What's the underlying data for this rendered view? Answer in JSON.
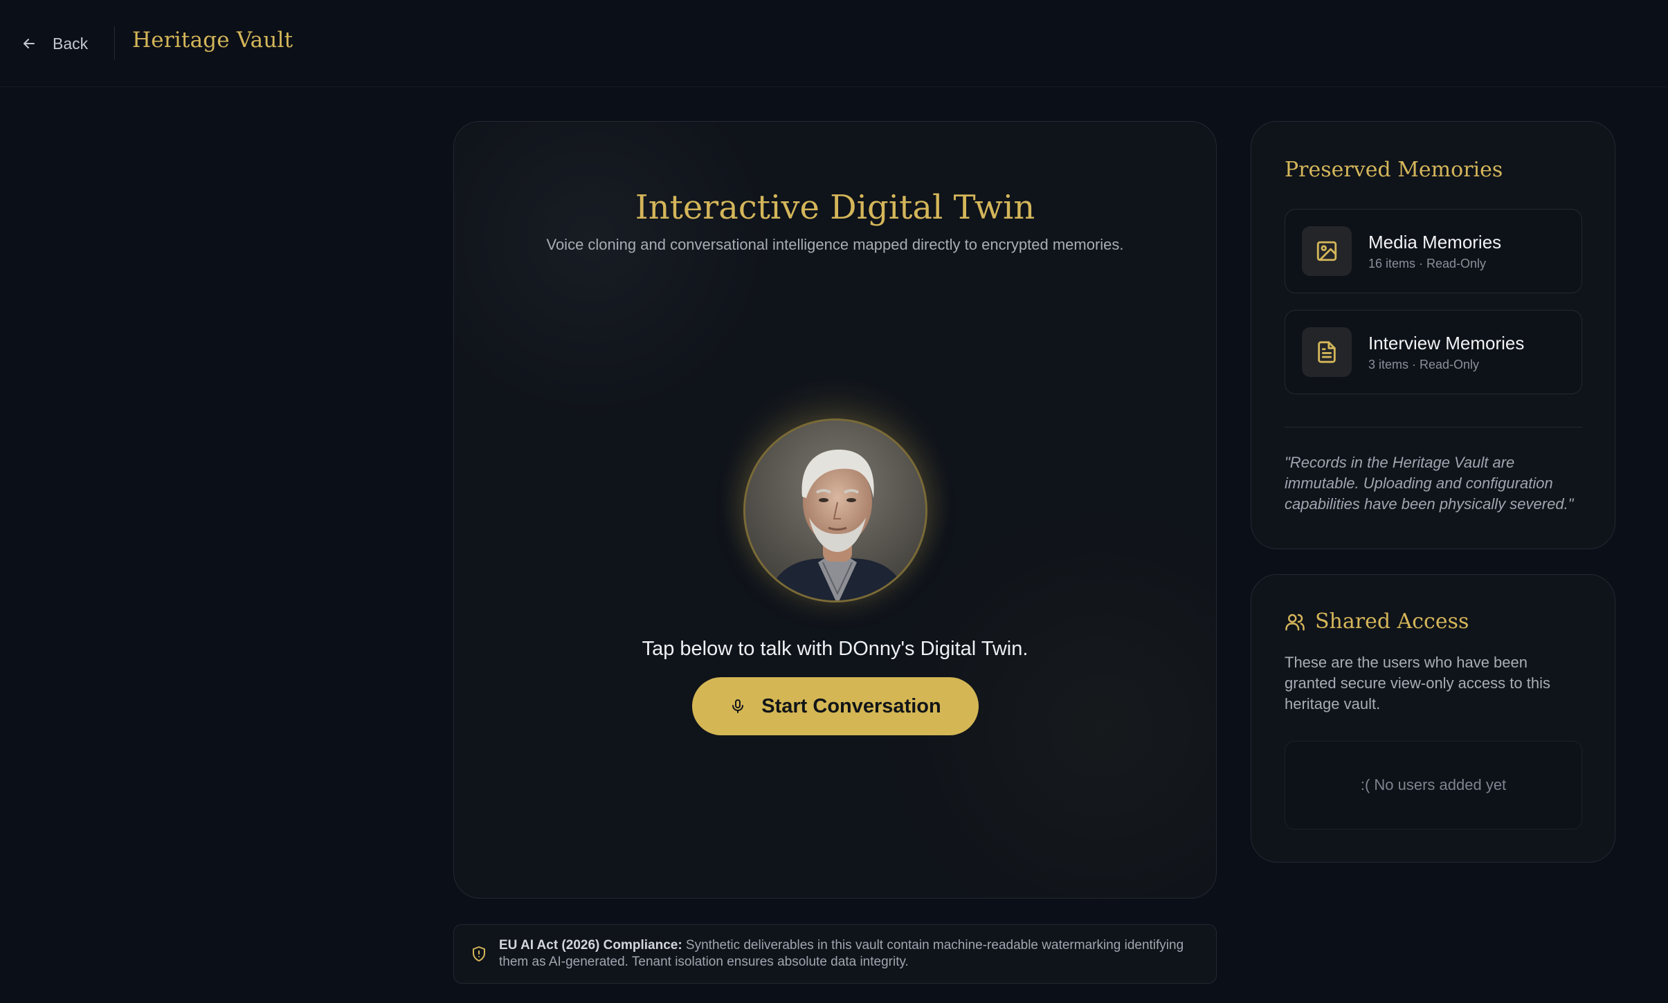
{
  "header": {
    "back_label": "Back",
    "brand": "Heritage Vault"
  },
  "main": {
    "title": "Interactive Digital Twin",
    "subtitle": "Voice cloning and conversational intelligence mapped directly to encrypted memories.",
    "prompt": "Tap below to talk with DOnny's Digital Twin.",
    "start_button": "Start Conversation"
  },
  "compliance": {
    "label": "EU AI Act (2026) Compliance:",
    "text": " Synthetic deliverables in this vault contain machine-readable watermarking identifying them as AI-generated. Tenant isolation ensures absolute data integrity."
  },
  "memories": {
    "title": "Preserved Memories",
    "items": [
      {
        "name": "Media Memories",
        "meta": "16 items · Read-Only",
        "icon": "image-icon"
      },
      {
        "name": "Interview Memories",
        "meta": "3 items · Read-Only",
        "icon": "document-icon"
      }
    ],
    "quote": "\"Records in the Heritage Vault are immutable. Uploading and configuration capabilities have been physically severed.\""
  },
  "access": {
    "title": "Shared Access",
    "description": "These are the users who have been granted secure view-only access to this heritage vault.",
    "empty": ":( No users added yet"
  },
  "colors": {
    "background": "#0b0f17",
    "accent_gold": "#d4b65a",
    "button_gold": "#d4b654",
    "card": "#0f131a"
  }
}
